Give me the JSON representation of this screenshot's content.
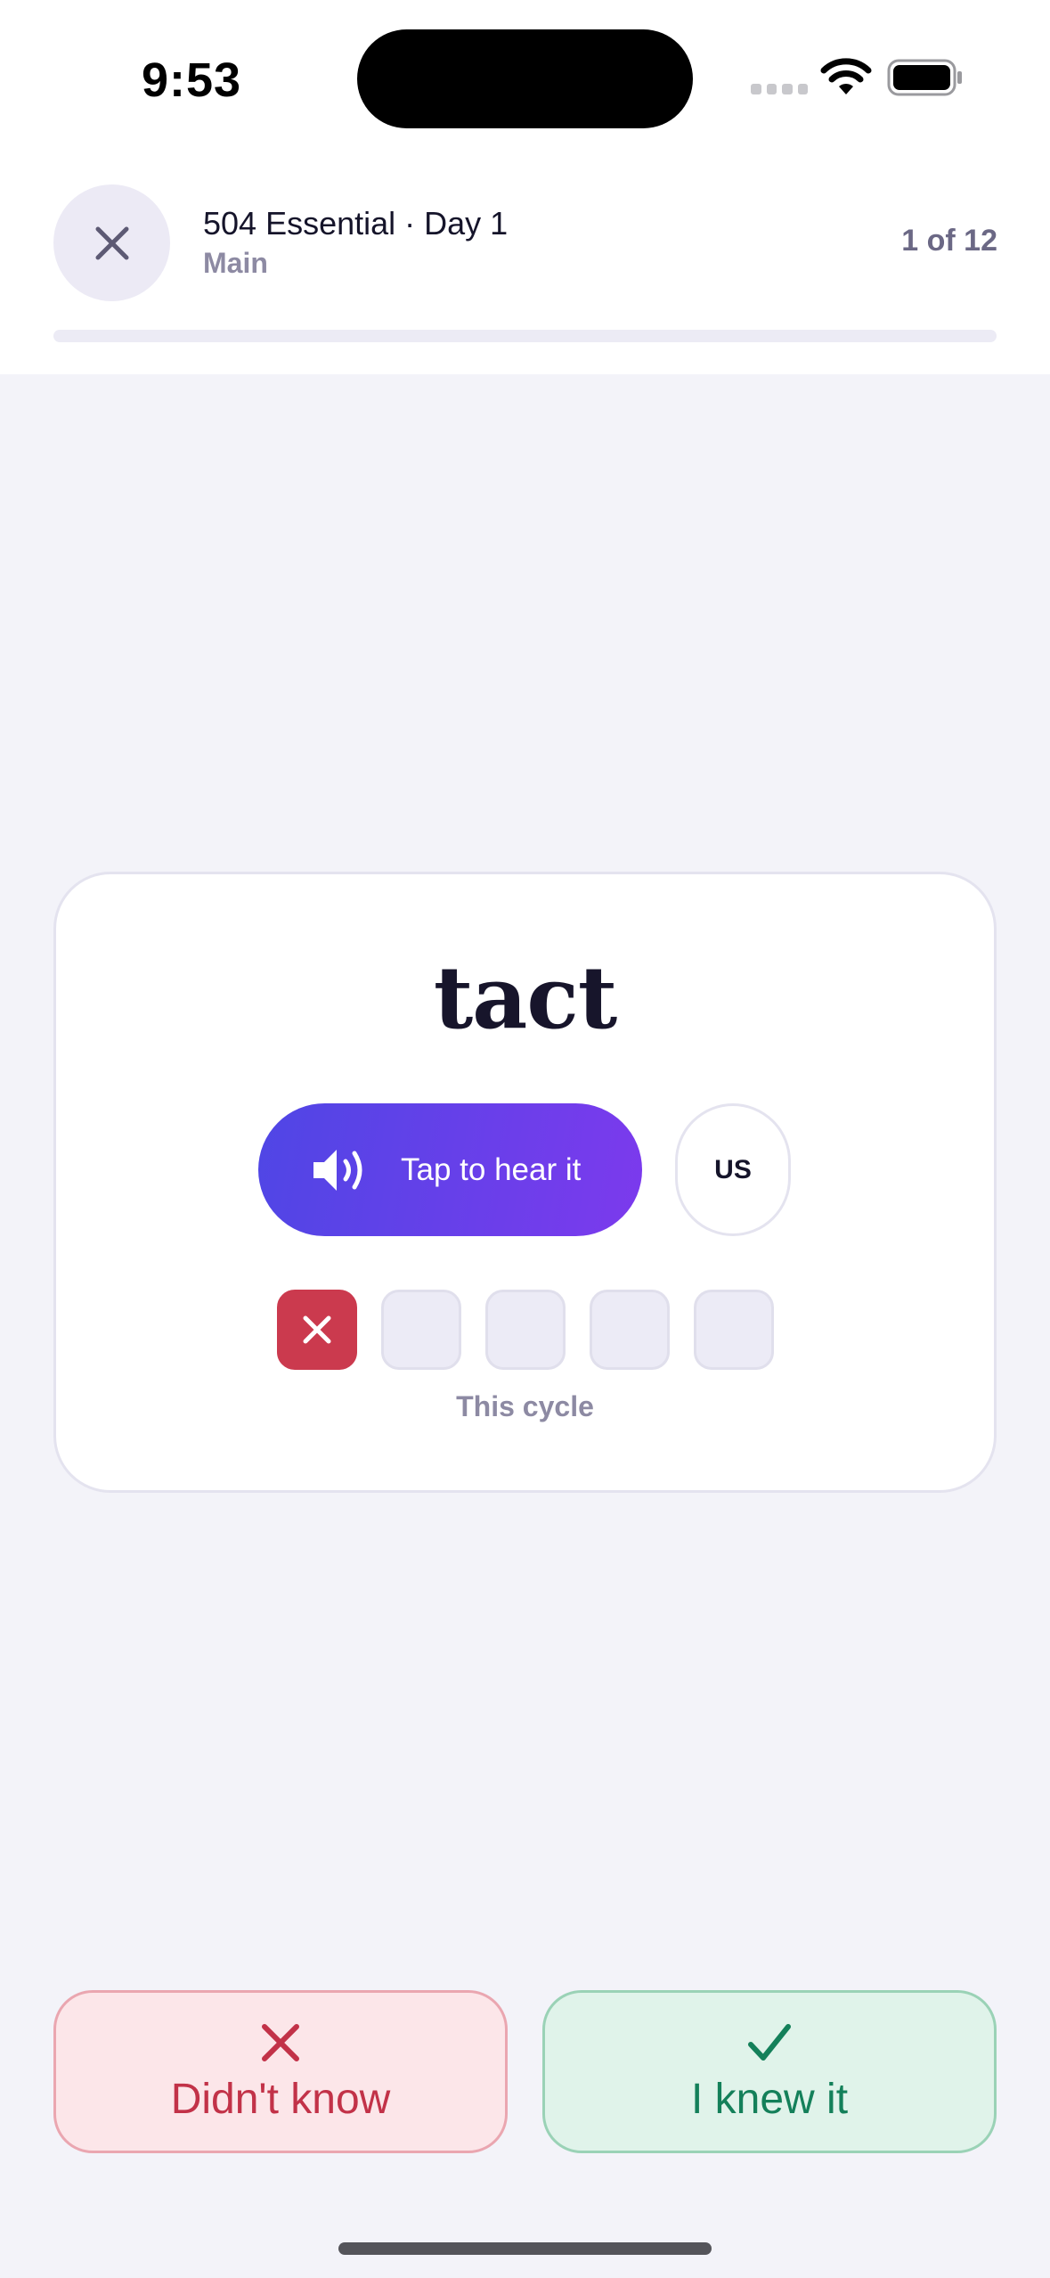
{
  "status_bar": {
    "time": "9:53",
    "signal_icon": "cellular-signal-icon",
    "wifi_icon": "wifi-icon",
    "battery_icon": "battery-icon"
  },
  "header": {
    "close_icon": "close-icon",
    "title": "504 Essential · Day 1",
    "subtitle": "Main",
    "counter": "1 of 12",
    "progress_fraction": 0.0
  },
  "card": {
    "word": "tact",
    "play_label": "Tap to hear it",
    "play_icon": "speaker-icon",
    "accent_label": "US",
    "cycle": [
      "miss",
      "empty",
      "empty",
      "empty",
      "empty"
    ],
    "cycle_label": "This cycle"
  },
  "actions": {
    "didnt_know_label": "Didn't know",
    "knew_label": "I knew it",
    "didnt_know_color": "#c23248",
    "knew_color": "#14805a"
  },
  "colors": {
    "accent_gradient_start": "#4f46e5",
    "accent_gradient_end": "#7c3aed",
    "miss_color": "#cb3a4e",
    "background": "#f3f3f9"
  }
}
